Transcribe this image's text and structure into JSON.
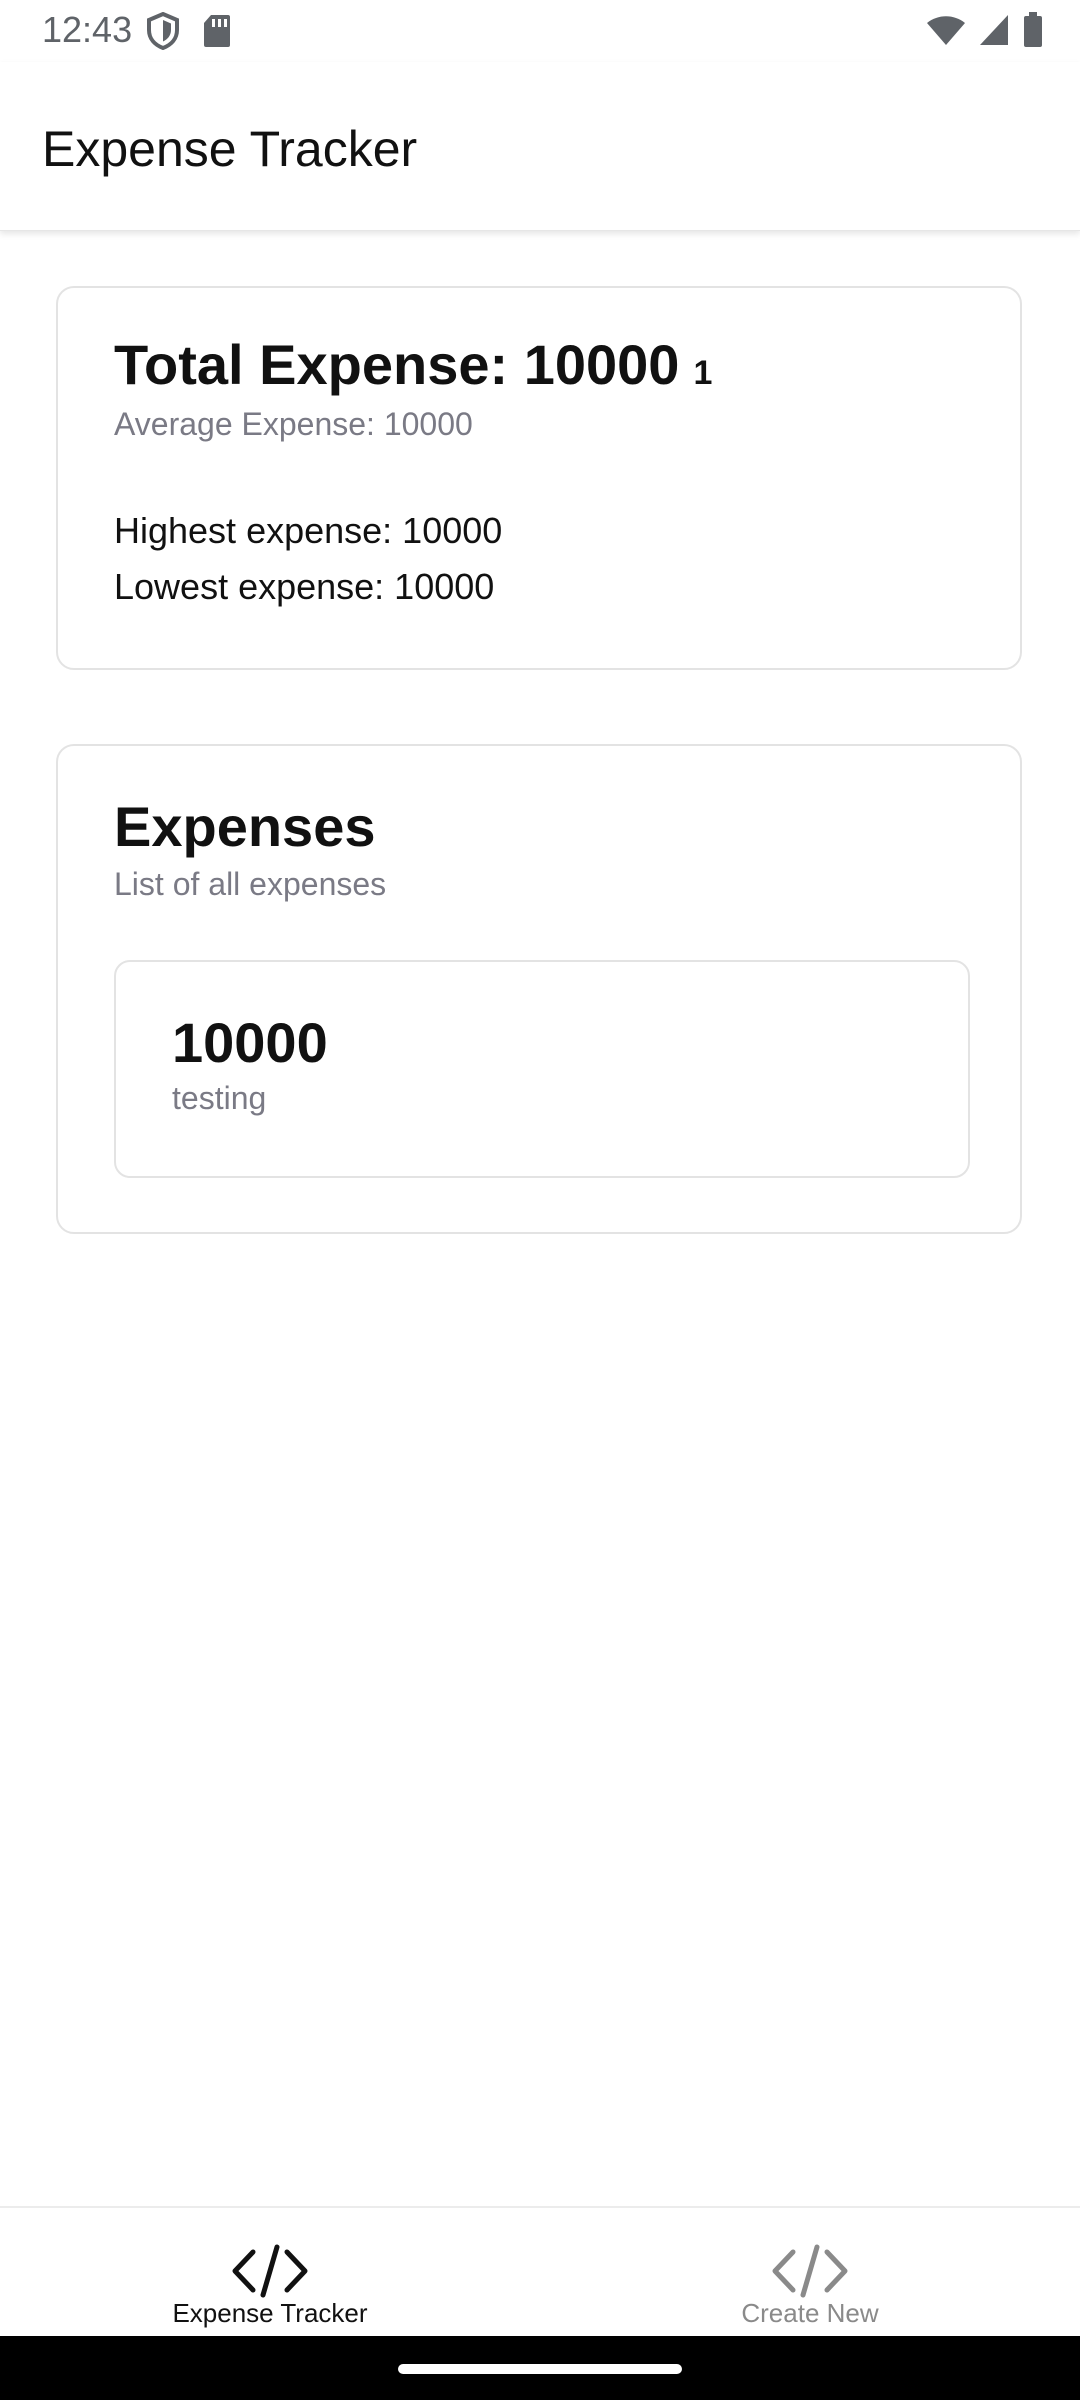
{
  "status_bar": {
    "time": "12:43",
    "left_icons": [
      "shield-icon",
      "sd-card-icon"
    ],
    "right_icons": [
      "wifi-icon",
      "signal-icon",
      "battery-icon"
    ]
  },
  "app_bar": {
    "title": "Expense Tracker"
  },
  "summary": {
    "title": "Total Expense: 10000",
    "count": "1",
    "average": "Average Expense: 10000",
    "highest": "Highest expense: 10000",
    "lowest": "Lowest expense: 10000"
  },
  "expenses": {
    "title": "Expenses",
    "subtitle": "List of all expenses",
    "items": [
      {
        "amount": "10000",
        "description": "testing"
      }
    ]
  },
  "bottom_nav": {
    "items": [
      {
        "label": "Expense Tracker",
        "icon": "code-icon",
        "active": true
      },
      {
        "label": "Create New",
        "icon": "code-icon",
        "active": false
      }
    ]
  },
  "colors": {
    "text_primary": "#111111",
    "text_secondary": "#7a7a85",
    "border": "#e3e3e3",
    "nav_inactive": "#8a8a8a"
  }
}
